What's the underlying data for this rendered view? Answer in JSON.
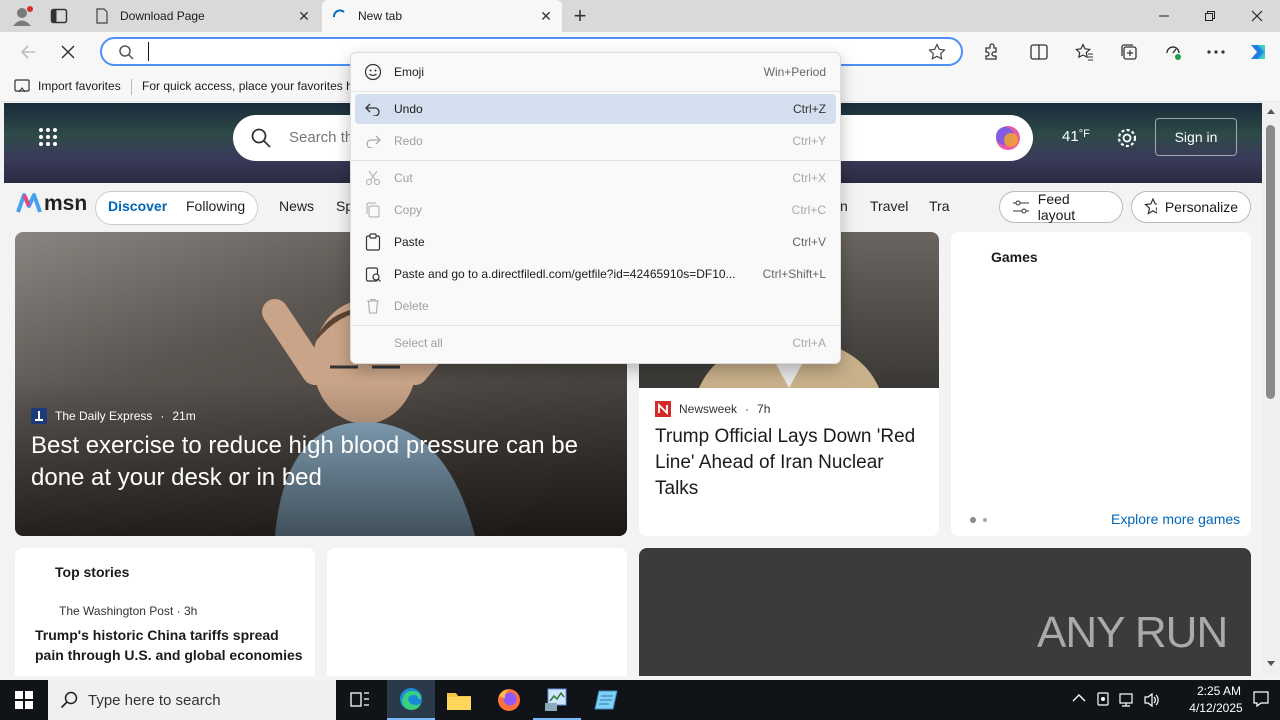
{
  "tabs": [
    {
      "label": "Download Page",
      "close": "✕"
    },
    {
      "label": "New tab",
      "close": "✕"
    }
  ],
  "newtab_symbol": "+",
  "address": {
    "value": "",
    "placeholder": ""
  },
  "favorites": {
    "import_label": "Import favorites",
    "hint": "For quick access, place your favorites he"
  },
  "msn": {
    "logo_text": "msn",
    "search_placeholder": "Search th",
    "temperature": "41",
    "temp_unit": "°F",
    "signin": "Sign in",
    "nav": {
      "discover": "Discover",
      "following": "Following",
      "news": "News",
      "sports_partial": "Sp",
      "partial_n": "n",
      "travel": "Travel",
      "traffic_partial": "Tra"
    },
    "feed_layout": "Feed layout",
    "personalize": "Personalize",
    "main_card": {
      "source": "The Daily Express",
      "time": "21m",
      "headline": "Best exercise to reduce high blood pressure can be done at your desk or in bed"
    },
    "mid_card": {
      "source": "Newsweek",
      "time": "7h",
      "headline": "Trump Official Lays Down 'Red Line' Ahead of Iran Nuclear Talks"
    },
    "games": {
      "title": "Games",
      "explore": "Explore more games"
    },
    "top_stories": {
      "title": "Top stories",
      "source": "The Washington Post",
      "time": "3h",
      "headline": "Trump's historic China tariffs spread pain through U.S. and global economies"
    },
    "watermark": "ANY RUN"
  },
  "context_menu": [
    {
      "label": "Emoji",
      "shortcut": "Win+Period",
      "icon": "emoji-icon",
      "disabled": false
    },
    {
      "label": "Undo",
      "shortcut": "Ctrl+Z",
      "icon": "undo-icon",
      "disabled": false
    },
    {
      "label": "Redo",
      "shortcut": "Ctrl+Y",
      "icon": "redo-icon",
      "disabled": true
    },
    {
      "label": "Cut",
      "shortcut": "Ctrl+X",
      "icon": "cut-icon",
      "disabled": true
    },
    {
      "label": "Copy",
      "shortcut": "Ctrl+C",
      "icon": "copy-icon",
      "disabled": true
    },
    {
      "label": "Paste",
      "shortcut": "Ctrl+V",
      "icon": "paste-icon",
      "disabled": false
    },
    {
      "label": "Paste and go to a.directfiledl.com/getfile?id=42465910s=DF10...",
      "shortcut": "Ctrl+Shift+L",
      "icon": "paste-go-icon",
      "disabled": false
    },
    {
      "label": "Delete",
      "shortcut": "",
      "icon": "delete-icon",
      "disabled": true
    },
    {
      "label": "Select all",
      "shortcut": "Ctrl+A",
      "icon": "",
      "disabled": true
    }
  ],
  "taskbar": {
    "search_placeholder": "Type here to search",
    "time": "2:25 AM",
    "date": "4/12/2025"
  },
  "colors": {
    "accent": "#4f8ff7",
    "menu_highlight": "#d3dfee",
    "msn_blue": "#0067b8",
    "taskbar": "#101418"
  }
}
